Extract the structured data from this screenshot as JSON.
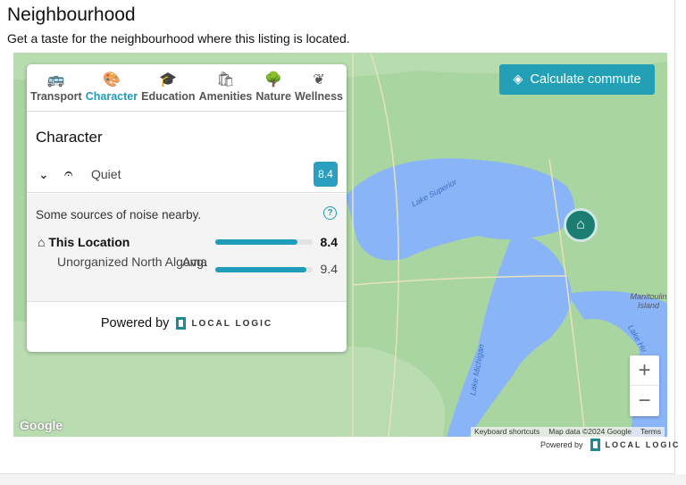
{
  "header": {
    "title": "Neighbourhood",
    "subtitle": "Get a taste for the neighbourhood where this listing is located."
  },
  "tabs": [
    {
      "label": "Transport",
      "icon": "car-bus-icon"
    },
    {
      "label": "Character",
      "icon": "palette-icon",
      "active": true
    },
    {
      "label": "Education",
      "icon": "graduation-cap-icon"
    },
    {
      "label": "Amenities",
      "icon": "shopping-bag-icon"
    },
    {
      "label": "Nature",
      "icon": "tree-icon"
    },
    {
      "label": "Wellness",
      "icon": "lotus-icon"
    }
  ],
  "panel": {
    "title": "Character",
    "item": {
      "label": "Quiet",
      "score": "8.4"
    },
    "description": "Some sources of noise nearby.",
    "this_location": {
      "label": "This Location",
      "value": "8.4",
      "fraction": 0.84
    },
    "average": {
      "label": "Unorganized North Algoma",
      "suffix": "Avg.",
      "value": "9.4",
      "fraction": 0.94
    },
    "powered_by": "Powered by",
    "brand": "LOCAL LOGIC"
  },
  "map": {
    "commute_button": "Calculate commute",
    "labels": {
      "superior": "Lake Superior",
      "michigan": "Lake Michigan",
      "huron": "Lake Hu",
      "manitoulin": "Manitoulin Island"
    },
    "google": "Google",
    "attribution": [
      "Keyboard shortcuts",
      "Map data ©2024 Google",
      "Terms"
    ],
    "zoom_in": "+",
    "zoom_out": "−"
  },
  "footer": {
    "powered_by": "Powered by",
    "brand": "LOCAL LOGIC"
  },
  "colors": {
    "accent": "#23a0b5",
    "marker": "#1c7d73",
    "water": "#8ab4f8",
    "land": "#a9d5a1"
  }
}
